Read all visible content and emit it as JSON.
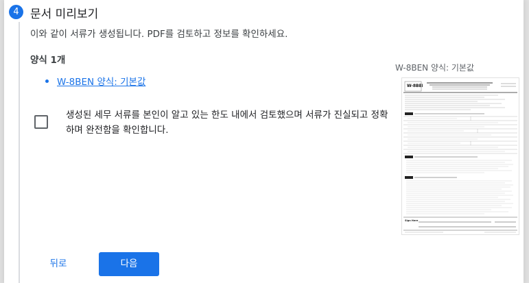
{
  "step": {
    "number": "4",
    "title": "문서 미리보기"
  },
  "subtitle": "이와 같이 서류가 생성됩니다. PDF를 검토하고 정보를 확인하세요.",
  "forms_count_label": "양식 1개",
  "documents": [
    {
      "label": "W-8BEN 양식: 기본값"
    }
  ],
  "confirmation": {
    "checked": false,
    "text": "생성된 세무 서류를 본인이 알고 있는 한도 내에서 검토했으며 서류가 진실되고 정확하며 완전함을 확인합니다."
  },
  "buttons": {
    "back": "뒤로",
    "next": "다음"
  },
  "preview": {
    "title": "W-8BEN 양식: 기본값",
    "form_name": "W-8BEN"
  },
  "colors": {
    "accent": "#1a73e8",
    "rail": "#dadce0"
  }
}
